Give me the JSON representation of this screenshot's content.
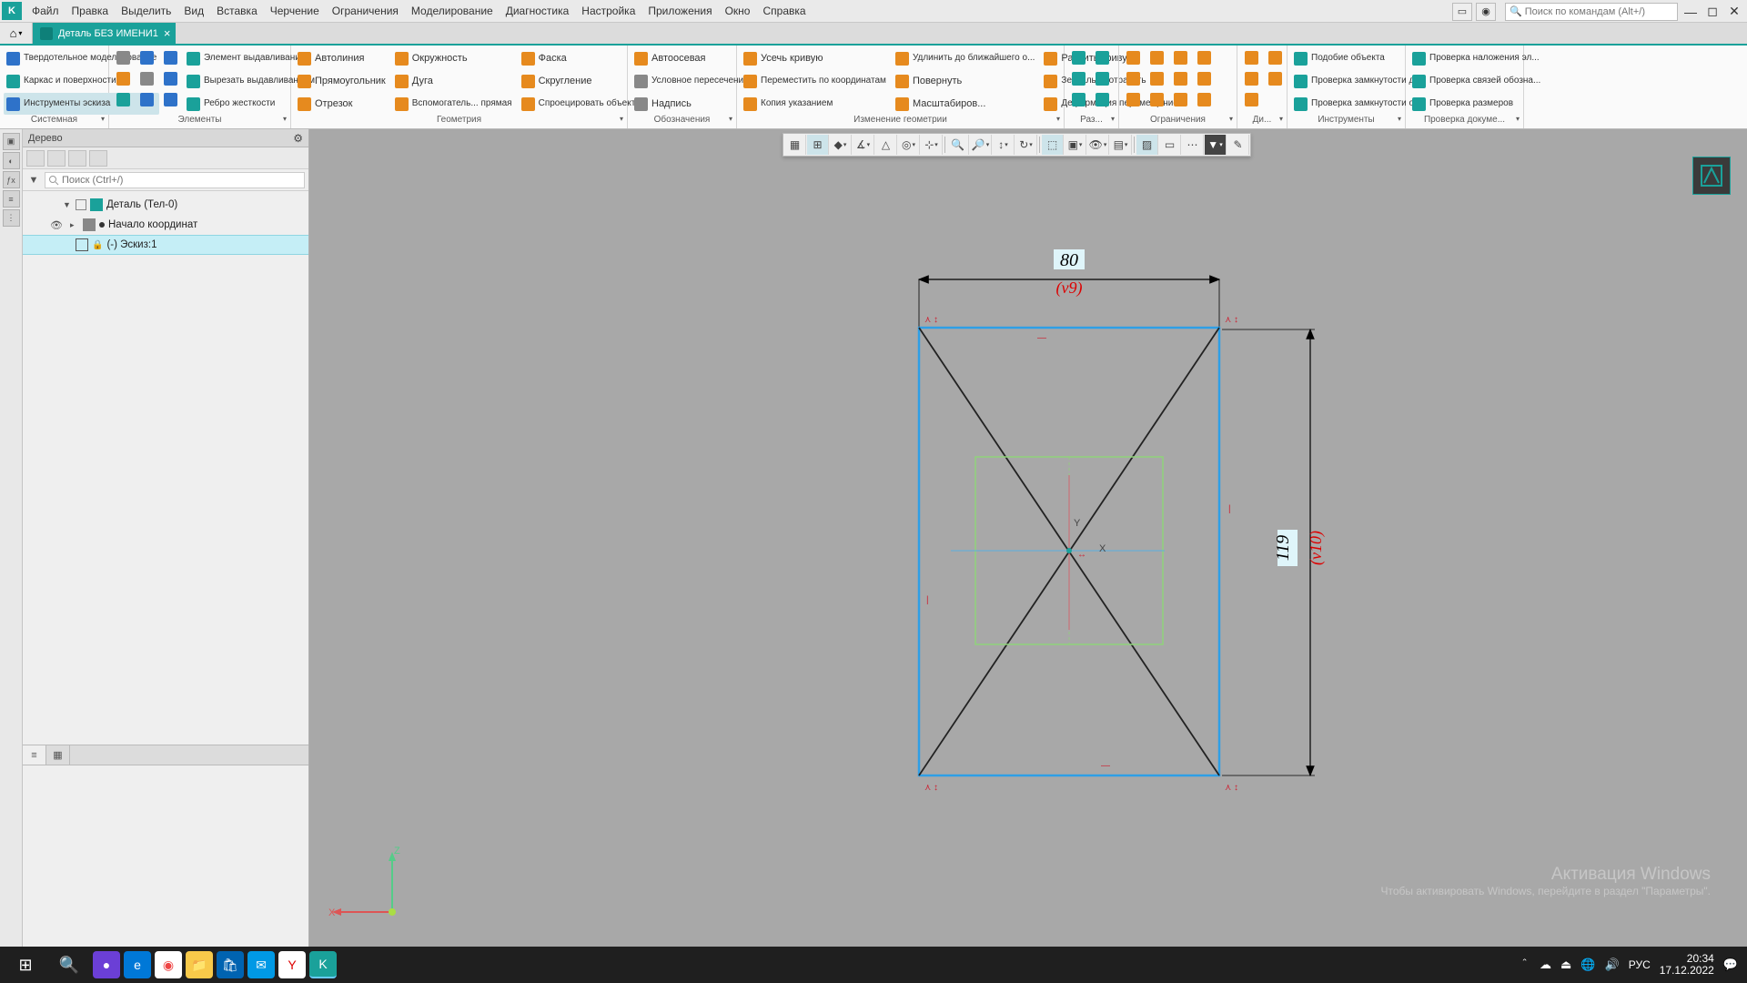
{
  "menus": [
    "Файл",
    "Правка",
    "Выделить",
    "Вид",
    "Вставка",
    "Черчение",
    "Ограничения",
    "Моделирование",
    "Диагностика",
    "Настройка",
    "Приложения",
    "Окно",
    "Справка"
  ],
  "search_placeholder": "Поиск по командам (Alt+/)",
  "doc_tab": "Деталь БЕЗ ИМЕНИ1",
  "side_panel": {
    "modes": [
      "Твердотельное моделирование",
      "Каркас и поверхности",
      "Инструменты эскиза"
    ],
    "group_title": "Системная"
  },
  "elements_group": {
    "title": "Элементы",
    "items": [
      "Элемент выдавливания",
      "Вырезать выдавливанием",
      "Ребро жесткости"
    ]
  },
  "geometry_group": {
    "title": "Геометрия",
    "col1": [
      "Автолиния",
      "Прямоугольник",
      "Отрезок"
    ],
    "col2": [
      "Окружность",
      "Дуга",
      "Вспомогатель... прямая"
    ],
    "col3": [
      "Фаска",
      "Скругление",
      "Спроецировать объект"
    ]
  },
  "labels_group": {
    "title": "Обозначения",
    "items": [
      "Автоосевая",
      "Условное пересечение",
      "Надпись"
    ]
  },
  "change_geom_group": {
    "title": "Изменение геометрии",
    "col1": [
      "Усечь кривую",
      "Переместить по координатам",
      "Копия указанием"
    ],
    "col2": [
      "Удлинить до ближайшего о...",
      "Повернуть",
      "Масштабиров..."
    ],
    "col3": [
      "Разбить кривую",
      "Зеркально отразить",
      "Деформация перемещением"
    ]
  },
  "groups_short": {
    "dims": "Раз...",
    "constraints": "Ограничения",
    "diag": "Ди...",
    "tools_t": "Инструменты",
    "doccheck": "Проверка докуме..."
  },
  "tools_group_items": [
    "Подобие объекта",
    "Проверка замкнутости д...",
    "Проверка замкнутости о..."
  ],
  "check_group_items": [
    "Проверка наложения эл...",
    "Проверка связей обозна...",
    "Проверка размеров"
  ],
  "tree": {
    "title": "Дерево",
    "search_placeholder": "Поиск (Ctrl+/)",
    "root": "Деталь (Тел-0)",
    "origin": "Начало координат",
    "sketch": "(-) Эскиз:1"
  },
  "drawing": {
    "top_dim": "80",
    "top_var": "(v9)",
    "right_dim": "119",
    "right_var": "(v10)",
    "y_label": "Y",
    "x_label": "X"
  },
  "ucs": {
    "x": "X",
    "z": "Z"
  },
  "watermark": {
    "l1": "Активация Windows",
    "l2": "Чтобы активировать Windows, перейдите в раздел \"Параметры\"."
  },
  "taskbar": {
    "lang": "РУС",
    "time": "20:34",
    "date": "17.12.2022"
  }
}
